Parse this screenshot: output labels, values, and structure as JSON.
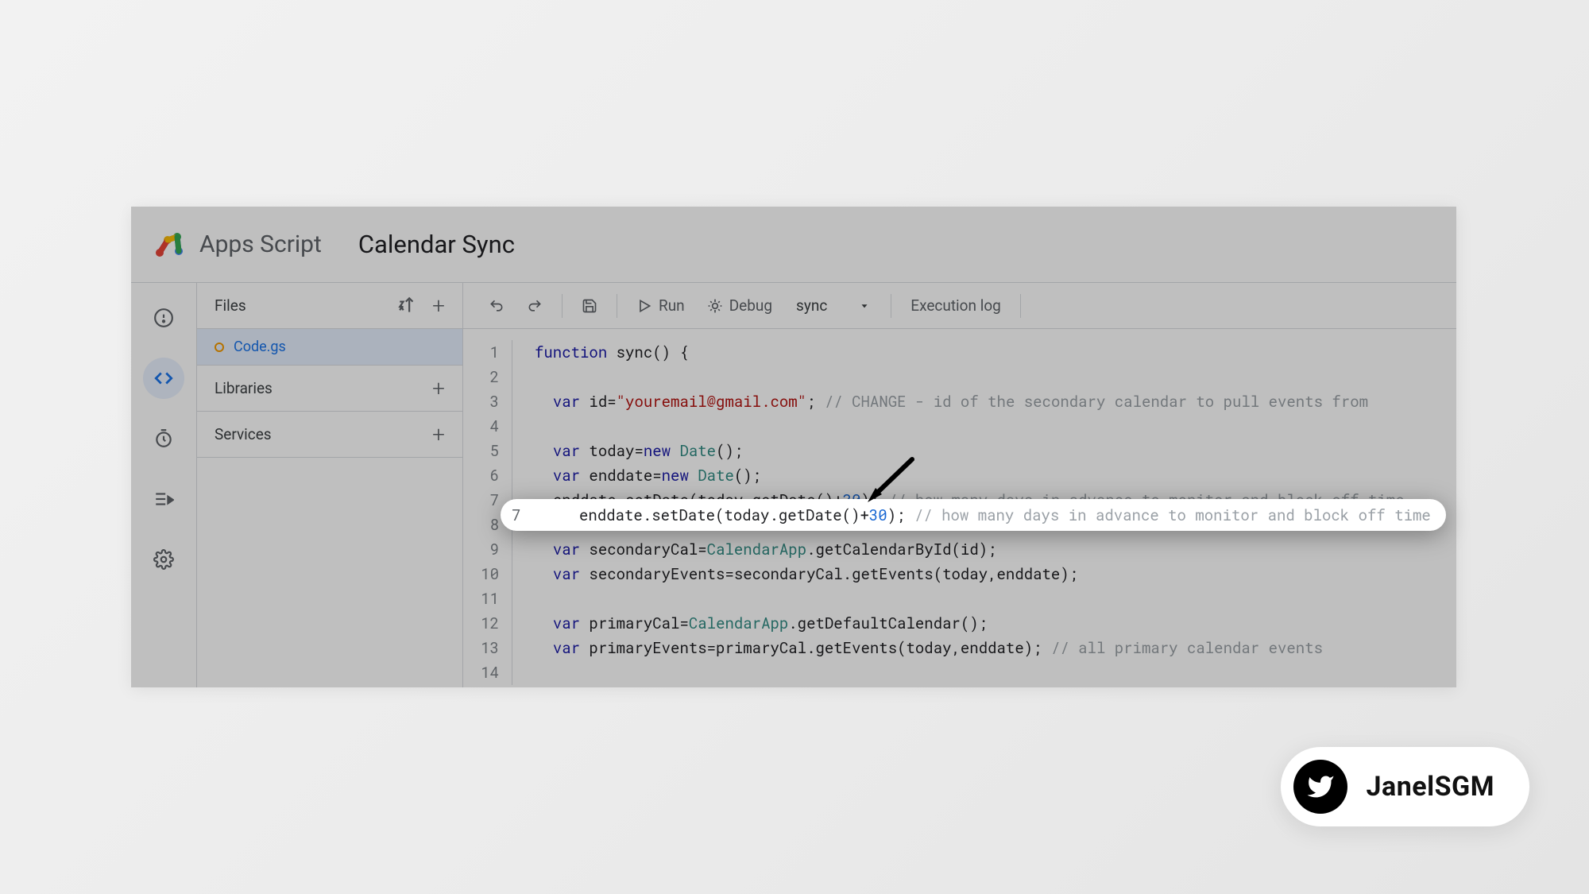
{
  "header": {
    "app_name": "Apps Script",
    "project_name": "Calendar Sync"
  },
  "sidebar": {
    "files_label": "Files",
    "libraries_label": "Libraries",
    "services_label": "Services",
    "file_name": "Code.gs"
  },
  "toolbar": {
    "run_label": "Run",
    "debug_label": "Debug",
    "function_selected": "sync",
    "execution_log_label": "Execution log"
  },
  "code": {
    "line1_kw": "function",
    "line1_rest": " sync() {",
    "line3_var": "var",
    "line3_a": " id=",
    "line3_str": "\"youremail@gmail.com\"",
    "line3_b": "; ",
    "line3_cmt": "// CHANGE - id of the secondary calendar to pull events from",
    "line5_var": "var",
    "line5_a": " today=",
    "line5_new": "new",
    "line5_cls": " Date",
    "line5_b": "();",
    "line6_var": "var",
    "line6_a": " enddate=",
    "line6_new": "new",
    "line6_cls": " Date",
    "line6_b": "();",
    "line7_num": "7",
    "line7_a": "enddate.setDate(today.getDate()+",
    "line7_val": "30",
    "line7_b": "); ",
    "line7_cmt": "// how many days in advance to monitor and block off time",
    "line9_var": "var",
    "line9_a": " secondaryCal=",
    "line9_cls": "CalendarApp",
    "line9_b": ".getCalendarById(id);",
    "line10_var": "var",
    "line10_a": " secondaryEvents=secondaryCal.getEvents(today,enddate);",
    "line12_var": "var",
    "line12_a": " primaryCal=",
    "line12_cls": "CalendarApp",
    "line12_b": ".getDefaultCalendar();",
    "line13_var": "var",
    "line13_a": " primaryEvents=primaryCal.getEvents(today,enddate); ",
    "line13_cmt": "// all primary calendar events",
    "gutters": [
      "1",
      "2",
      "3",
      "4",
      "5",
      "6",
      "7",
      "8",
      "9",
      "10",
      "11",
      "12",
      "13",
      "14"
    ]
  },
  "credit": {
    "handle": "JanelSGM"
  }
}
